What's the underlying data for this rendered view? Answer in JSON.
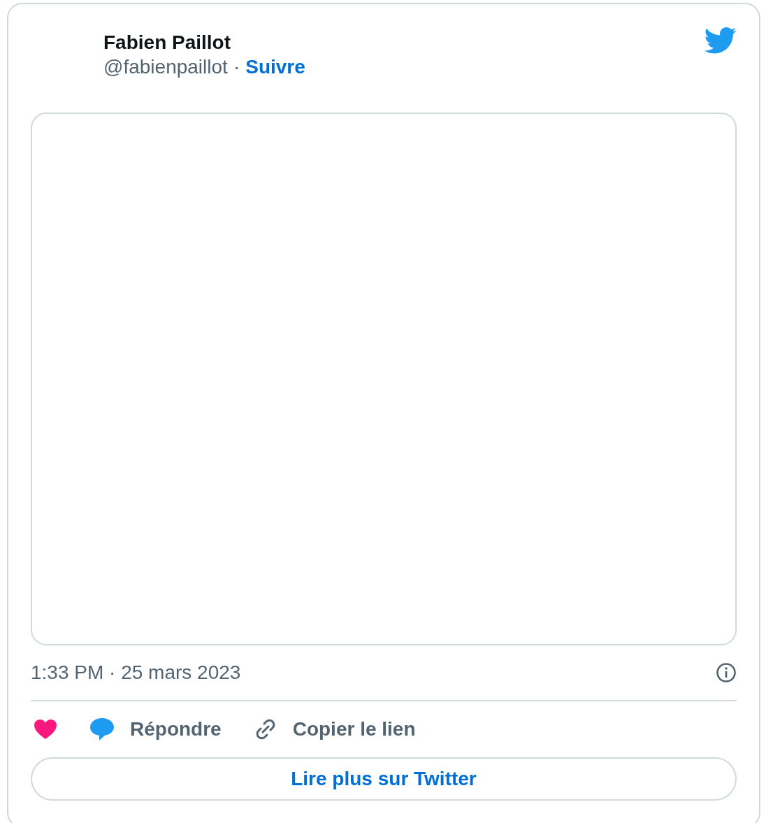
{
  "author": {
    "name": "Fabien Paillot",
    "handle": "@fabienpaillot",
    "separator": "·",
    "follow": "Suivre"
  },
  "media": {
    "kind": "empty"
  },
  "timestamp": "1:33 PM · 25 mars 2023",
  "actions": [
    {
      "kind": "like"
    },
    {
      "kind": "reply",
      "label": "Répondre"
    },
    {
      "kind": "copy",
      "label": "Copier le lien"
    }
  ],
  "read_more": "Lire plus sur Twitter"
}
